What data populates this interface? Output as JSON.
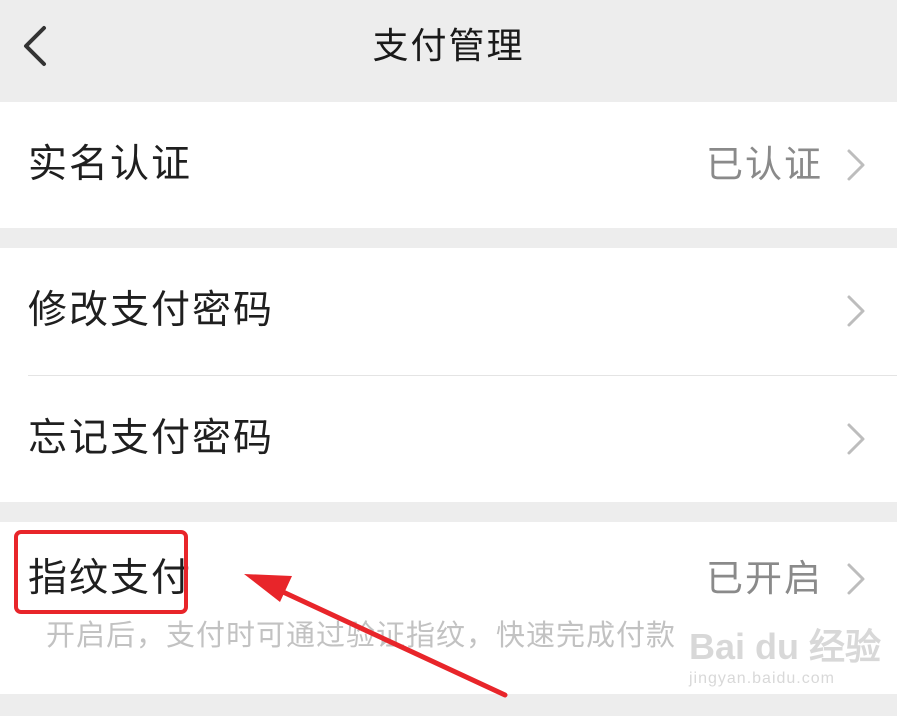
{
  "header": {
    "title": "支付管理",
    "back_icon": "chevron-left-icon"
  },
  "groups": [
    {
      "rows": [
        {
          "label": "实名认证",
          "value": "已认证"
        }
      ]
    },
    {
      "rows": [
        {
          "label": "修改支付密码",
          "value": ""
        },
        {
          "label": "忘记支付密码",
          "value": ""
        }
      ]
    },
    {
      "rows": [
        {
          "label": "指纹支付",
          "value": "已开启"
        }
      ],
      "hint": "开启后，支付时可通过验证指纹，快速完成付款"
    }
  ],
  "annotation": {
    "highlight_color": "#e8252a",
    "arrow_color": "#e8252a"
  },
  "watermark": {
    "brand": "Bai du 经验",
    "url": "jingyan.baidu.com"
  },
  "colors": {
    "background": "#ededed",
    "card": "#ffffff",
    "text_primary": "#1f1f1f",
    "text_secondary": "#8a8a8a",
    "hint_text": "#c2c2c2",
    "chevron": "#bdbdbd"
  }
}
